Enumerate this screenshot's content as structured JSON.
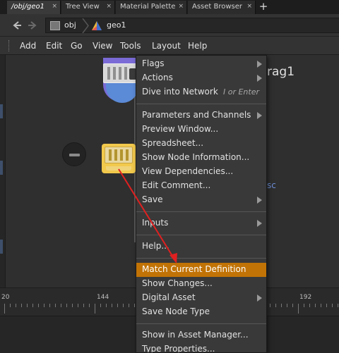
{
  "tabs": [
    {
      "label": "/obj/geo1",
      "close": "×",
      "active": true
    },
    {
      "label": "Tree View",
      "close": "×",
      "active": false
    },
    {
      "label": "Material Palette",
      "close": "×",
      "active": false
    },
    {
      "label": "Asset Browser",
      "close": "×",
      "active": false
    }
  ],
  "tab_add_label": "+",
  "path": {
    "root": "obj",
    "current": "geo1"
  },
  "menubar": [
    "Add",
    "Edit",
    "Go",
    "View",
    "Tools",
    "Layout",
    "Help"
  ],
  "network": {
    "node_label_top": "rag1",
    "node_label_bottom": "sc"
  },
  "timeline": {
    "ticks": [
      "20",
      "144",
      "192"
    ]
  },
  "context_menu": {
    "groups": [
      [
        {
          "label": "Flags",
          "submenu": true
        },
        {
          "label": "Actions",
          "submenu": true
        },
        {
          "label": "Dive into Network",
          "shortcut": "I or Enter"
        }
      ],
      [
        {
          "label": "Parameters and Channels",
          "submenu": true
        },
        {
          "label": "Preview Window..."
        },
        {
          "label": "Spreadsheet..."
        },
        {
          "label": "Show Node Information..."
        },
        {
          "label": "View Dependencies..."
        },
        {
          "label": "Edit Comment..."
        },
        {
          "label": "Save",
          "submenu": true
        }
      ],
      [
        {
          "label": "Inputs",
          "submenu": true
        }
      ],
      [
        {
          "label": "Help..."
        }
      ],
      [
        {
          "label": "Match Current Definition",
          "highlighted": true
        },
        {
          "label": "Show Changes..."
        },
        {
          "label": "Digital Asset",
          "submenu": true
        },
        {
          "label": "Save Node Type"
        }
      ],
      [
        {
          "label": "Show in Asset Manager..."
        },
        {
          "label": "Type Properties..."
        }
      ]
    ]
  },
  "colors": {
    "highlight": "#c17306",
    "annotation_arrow": "#e02020",
    "selected_node": "#f2c94c",
    "link_text": "#6e8fd6"
  }
}
